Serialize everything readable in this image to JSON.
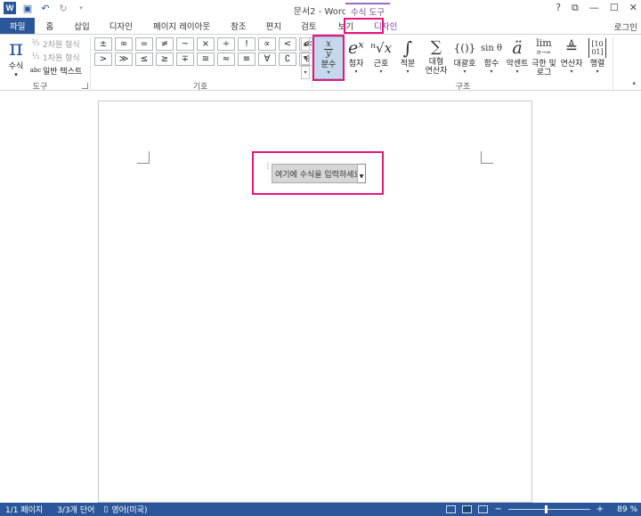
{
  "window": {
    "title": "문서2 - Word",
    "context_group": "수식 도구",
    "controls": [
      "?",
      "⧉",
      "—",
      "☐",
      "✕"
    ]
  },
  "qat": {
    "save_icon": "save-icon",
    "undo_icon": "undo-icon",
    "redo_icon": "redo-icon"
  },
  "tabs": {
    "file": "파일",
    "items": [
      "홈",
      "삽입",
      "디자인",
      "페이지 레이아웃",
      "참조",
      "편지",
      "검토",
      "보기"
    ],
    "context_design": "디자인",
    "login": "로그인"
  },
  "ribbon": {
    "tools": {
      "label": "도구",
      "equation_label": "수식",
      "professional": "2차원 형식",
      "linear": "1차원 형식",
      "normal_text": "일반 텍스트"
    },
    "symbols": {
      "label": "기호",
      "row1": [
        "±",
        "∞",
        "=",
        "≠",
        "~",
        "×",
        "÷",
        "!",
        "∝",
        "<",
        "≪"
      ],
      "row2": [
        ">",
        "≫",
        "≤",
        "≥",
        "∓",
        "≅",
        "≈",
        "≡",
        "∀",
        "∁",
        "∂"
      ]
    },
    "structures": {
      "label": "구조",
      "items": [
        {
          "glyph_top": "x",
          "glyph_bottom": "y",
          "label": "분수"
        },
        {
          "glyph": "eˣ",
          "label": "첨자"
        },
        {
          "glyph": "ⁿ√x",
          "label": "근호"
        },
        {
          "glyph": "∫",
          "label": "적분"
        },
        {
          "glyph": "∑",
          "label1": "대형",
          "label2": "연산자"
        },
        {
          "glyph": "{()}",
          "label": "대괄호"
        },
        {
          "glyph": "sin θ",
          "label": "함수"
        },
        {
          "glyph": "ä",
          "label": "악센트"
        },
        {
          "glyph_top": "lim",
          "glyph_bottom": "n→∞",
          "label1": "극한 및",
          "label2": "로그"
        },
        {
          "glyph": "≜",
          "label": "연산자"
        },
        {
          "glyph": "[10 01]",
          "label": "행렬"
        }
      ]
    }
  },
  "document": {
    "equation_placeholder": "여기에 수식을 입력하세요."
  },
  "status": {
    "page": "1/1 페이지",
    "words": "3/3개 단어",
    "language": "영어(미국)",
    "zoom": "89 %",
    "zoom_level": 0.89
  },
  "colors": {
    "accent": "#2b579a",
    "context": "#7b3fa0",
    "highlight": "#e8157f"
  }
}
